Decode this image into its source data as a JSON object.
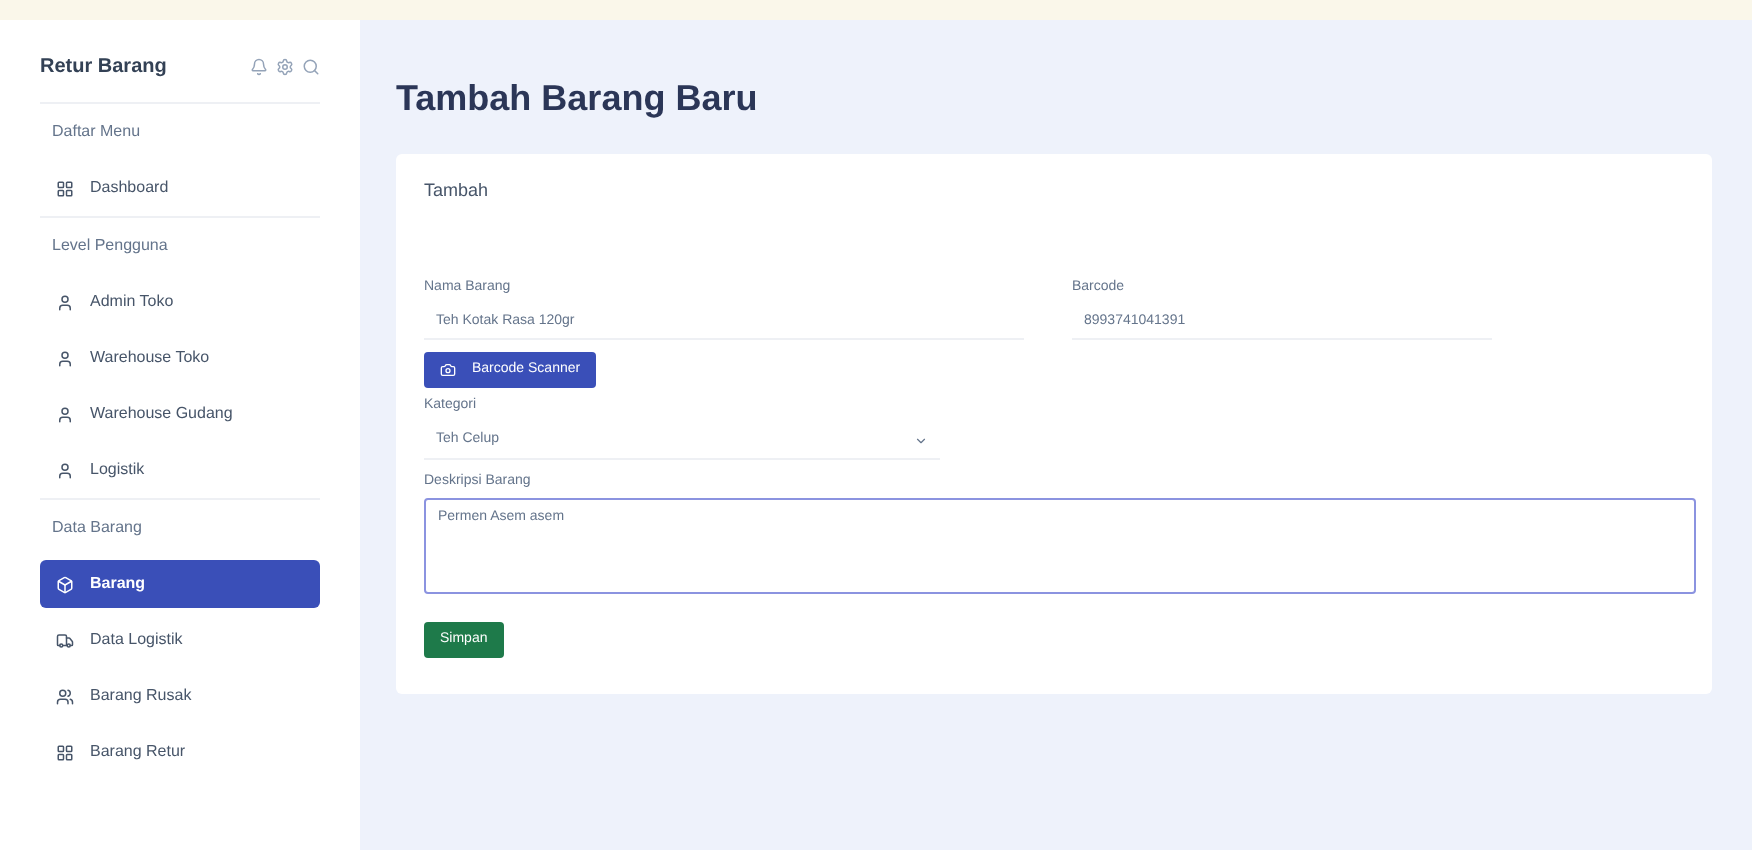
{
  "sidebar": {
    "brand": "Retur Barang",
    "sections": [
      {
        "heading": "Daftar Menu",
        "items": [
          {
            "label": "Dashboard",
            "kind": "grid",
            "selected": false
          }
        ]
      },
      {
        "heading": "Level Pengguna",
        "items": [
          {
            "label": "Admin Toko",
            "kind": "user",
            "selected": false
          },
          {
            "label": "Warehouse Toko",
            "kind": "user",
            "selected": false
          },
          {
            "label": "Warehouse Gudang",
            "kind": "user",
            "selected": false
          },
          {
            "label": "Logistik",
            "kind": "user",
            "selected": false
          }
        ]
      },
      {
        "heading": "Data Barang",
        "items": [
          {
            "label": "Barang",
            "kind": "box",
            "selected": true
          },
          {
            "label": "Data Logistik",
            "kind": "truck",
            "selected": false
          },
          {
            "label": "Barang Rusak",
            "kind": "people",
            "selected": false
          },
          {
            "label": "Barang Retur",
            "kind": "grid",
            "selected": false
          }
        ]
      }
    ]
  },
  "page_title": "Tambah Barang Baru",
  "card": {
    "title": "Tambah",
    "name_field": {
      "label": "Nama Barang",
      "value": "Teh Kotak Rasa 120gr"
    },
    "barcode_field": {
      "label": "Barcode",
      "value": "8993741041391"
    },
    "scan_button": "Barcode Scanner",
    "category": {
      "label": "Kategori",
      "value": "Teh Celup"
    },
    "description": {
      "label": "Deskripsi Barang",
      "value": "Permen Asem asem"
    },
    "save_button": "Simpan"
  }
}
